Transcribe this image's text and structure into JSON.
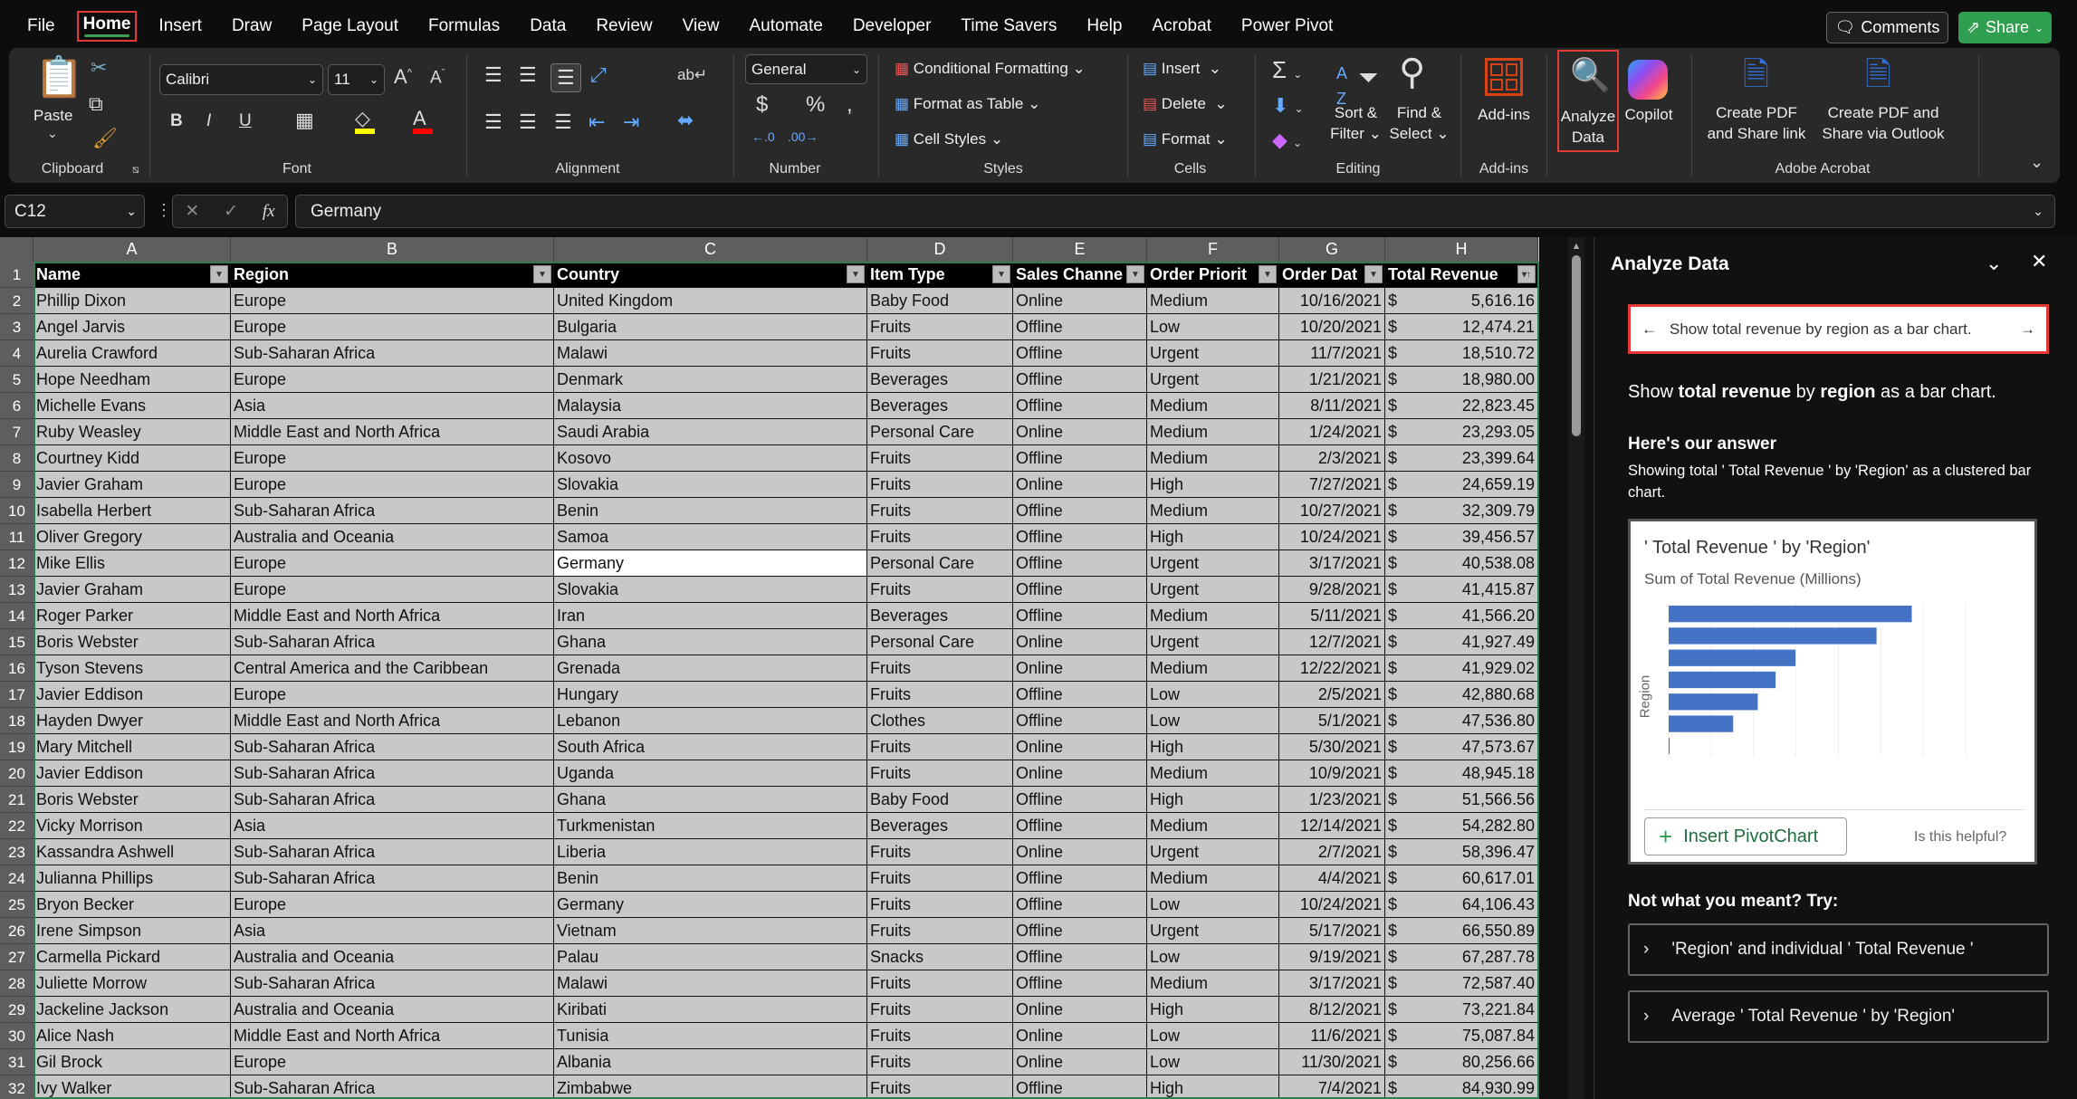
{
  "menu": [
    "File",
    "Home",
    "Insert",
    "Draw",
    "Page Layout",
    "Formulas",
    "Data",
    "Review",
    "View",
    "Automate",
    "Developer",
    "Time Savers",
    "Help",
    "Acrobat",
    "Power Pivot"
  ],
  "top_buttons": {
    "comments": "Comments",
    "share": "Share"
  },
  "ribbon": {
    "clipboard": {
      "paste": "Paste",
      "label": "Clipboard"
    },
    "font": {
      "name": "Calibri",
      "size": "11",
      "bold": "B",
      "italic": "I",
      "underline": "U",
      "label": "Font",
      "highlight_color": "#ffff00",
      "font_color": "#ff0000"
    },
    "alignment": {
      "label": "Alignment"
    },
    "number": {
      "format": "General",
      "label": "Number"
    },
    "styles": {
      "conditional": "Conditional Formatting",
      "table": "Format as Table",
      "cell": "Cell Styles",
      "label": "Styles"
    },
    "cells": {
      "insert": "Insert",
      "delete": "Delete",
      "format": "Format",
      "label": "Cells"
    },
    "editing": {
      "sort1": "Sort &",
      "sort2": "Filter",
      "find1": "Find &",
      "find2": "Select",
      "label": "Editing"
    },
    "addins": {
      "button": "Add-ins",
      "label": "Add-ins"
    },
    "analyze": {
      "line1": "Analyze",
      "line2": "Data"
    },
    "copilot": "Copilot",
    "acrobat": {
      "pdf_link1": "Create PDF",
      "pdf_link2": "and Share link",
      "pdf_outlook1": "Create PDF and",
      "pdf_outlook2": "Share via Outlook",
      "label": "Adobe Acrobat"
    }
  },
  "formula_bar": {
    "name_box": "C12",
    "value": "Germany",
    "fx": "fx"
  },
  "table": {
    "columns": [
      "A",
      "B",
      "C",
      "D",
      "E",
      "F",
      "G",
      "H"
    ],
    "headers": [
      "Name",
      "Region",
      "Country",
      "Item Type",
      "Sales Channe",
      "Order Priorit",
      "Order Dat",
      "Total Revenue"
    ],
    "currency": "$",
    "rows": [
      [
        "Phillip Dixon",
        "Europe",
        "United Kingdom",
        "Baby Food",
        "Online",
        "Medium",
        "10/16/2021",
        "5,616.16"
      ],
      [
        "Angel Jarvis",
        "Europe",
        "Bulgaria",
        "Fruits",
        "Offline",
        "Low",
        "10/20/2021",
        "12,474.21"
      ],
      [
        "Aurelia Crawford",
        "Sub-Saharan Africa",
        "Malawi",
        "Fruits",
        "Offline",
        "Urgent",
        "11/7/2021",
        "18,510.72"
      ],
      [
        "Hope Needham",
        "Europe",
        "Denmark",
        "Beverages",
        "Offline",
        "Urgent",
        "1/21/2021",
        "18,980.00"
      ],
      [
        "Michelle Evans",
        "Asia",
        "Malaysia",
        "Beverages",
        "Offline",
        "Medium",
        "8/11/2021",
        "22,823.45"
      ],
      [
        "Ruby Weasley",
        "Middle East and North Africa",
        "Saudi Arabia",
        "Personal Care",
        "Online",
        "Medium",
        "1/24/2021",
        "23,293.05"
      ],
      [
        "Courtney Kidd",
        "Europe",
        "Kosovo",
        "Fruits",
        "Offline",
        "Medium",
        "2/3/2021",
        "23,399.64"
      ],
      [
        "Javier Graham",
        "Europe",
        "Slovakia",
        "Fruits",
        "Online",
        "High",
        "7/27/2021",
        "24,659.19"
      ],
      [
        "Isabella Herbert",
        "Sub-Saharan Africa",
        "Benin",
        "Fruits",
        "Offline",
        "Medium",
        "10/27/2021",
        "32,309.79"
      ],
      [
        "Oliver Gregory",
        "Australia and Oceania",
        "Samoa",
        "Fruits",
        "Offline",
        "High",
        "10/24/2021",
        "39,456.57"
      ],
      [
        "Mike Ellis",
        "Europe",
        "Germany",
        "Personal Care",
        "Offline",
        "Urgent",
        "3/17/2021",
        "40,538.08"
      ],
      [
        "Javier Graham",
        "Europe",
        "Slovakia",
        "Fruits",
        "Offline",
        "Urgent",
        "9/28/2021",
        "41,415.87"
      ],
      [
        "Roger Parker",
        "Middle East and North Africa",
        "Iran",
        "Beverages",
        "Offline",
        "Medium",
        "5/11/2021",
        "41,566.20"
      ],
      [
        "Boris Webster",
        "Sub-Saharan Africa",
        "Ghana",
        "Personal Care",
        "Online",
        "Urgent",
        "12/7/2021",
        "41,927.49"
      ],
      [
        "Tyson Stevens",
        "Central America and the Caribbean",
        "Grenada",
        "Fruits",
        "Online",
        "Medium",
        "12/22/2021",
        "41,929.02"
      ],
      [
        "Javier Eddison",
        "Europe",
        "Hungary",
        "Fruits",
        "Offline",
        "Low",
        "2/5/2021",
        "42,880.68"
      ],
      [
        "Hayden Dwyer",
        "Middle East and North Africa",
        "Lebanon",
        "Clothes",
        "Offline",
        "Low",
        "5/1/2021",
        "47,536.80"
      ],
      [
        "Mary Mitchell",
        "Sub-Saharan Africa",
        "South Africa",
        "Fruits",
        "Online",
        "High",
        "5/30/2021",
        "47,573.67"
      ],
      [
        "Javier Eddison",
        "Sub-Saharan Africa",
        "Uganda",
        "Fruits",
        "Online",
        "Medium",
        "10/9/2021",
        "48,945.18"
      ],
      [
        "Boris Webster",
        "Sub-Saharan Africa",
        "Ghana",
        "Baby Food",
        "Offline",
        "High",
        "1/23/2021",
        "51,566.56"
      ],
      [
        "Vicky Morrison",
        "Asia",
        "Turkmenistan",
        "Beverages",
        "Offline",
        "Medium",
        "12/14/2021",
        "54,282.80"
      ],
      [
        "Kassandra Ashwell",
        "Sub-Saharan Africa",
        "Liberia",
        "Fruits",
        "Online",
        "Urgent",
        "2/7/2021",
        "58,396.47"
      ],
      [
        "Julianna Phillips",
        "Sub-Saharan Africa",
        "Benin",
        "Fruits",
        "Offline",
        "Medium",
        "4/4/2021",
        "60,617.01"
      ],
      [
        "Bryon Becker",
        "Europe",
        "Germany",
        "Fruits",
        "Offline",
        "Low",
        "10/24/2021",
        "64,106.43"
      ],
      [
        "Irene Simpson",
        "Asia",
        "Vietnam",
        "Fruits",
        "Offline",
        "Urgent",
        "5/17/2021",
        "66,550.89"
      ],
      [
        "Carmella Pickard",
        "Australia and Oceania",
        "Palau",
        "Snacks",
        "Offline",
        "Low",
        "9/19/2021",
        "67,287.78"
      ],
      [
        "Juliette Morrow",
        "Sub-Saharan Africa",
        "Malawi",
        "Fruits",
        "Offline",
        "Medium",
        "3/17/2021",
        "72,587.40"
      ],
      [
        "Jackeline Jackson",
        "Australia and Oceania",
        "Kiribati",
        "Fruits",
        "Online",
        "High",
        "8/12/2021",
        "73,221.84"
      ],
      [
        "Alice Nash",
        "Middle East and North Africa",
        "Tunisia",
        "Fruits",
        "Online",
        "Low",
        "11/6/2021",
        "75,087.84"
      ],
      [
        "Gil Brock",
        "Europe",
        "Albania",
        "Fruits",
        "Online",
        "Low",
        "11/30/2021",
        "80,256.66"
      ],
      [
        "Ivy Walker",
        "Sub-Saharan Africa",
        "Zimbabwe",
        "Fruits",
        "Offline",
        "High",
        "7/4/2021",
        "84,930.99"
      ]
    ]
  },
  "panel": {
    "title": "Analyze Data",
    "query": "Show total revenue by region as a bar chart.",
    "echo": {
      "a": "Show ",
      "b": "total revenue",
      "c": " by ",
      "d": "region",
      "e": " as a bar chart."
    },
    "answer_heading": "Here's our answer",
    "answer_desc": "Showing total ' Total Revenue ' by 'Region' as a clustered bar chart.",
    "insert_button": "Insert PivotChart",
    "helpful": "Is this helpful?",
    "not_meant": "Not what you meant? Try:",
    "suggestions": [
      "'Region' and individual ' Total Revenue '",
      "Average ' Total Revenue ' by 'Region'"
    ]
  },
  "chart_data": {
    "type": "bar",
    "orientation": "horizontal",
    "title": "' Total Revenue ' by 'Region'",
    "subtitle": "Sum of Total Revenue (Millions)",
    "ylabel": "Region",
    "values": [
      5.73,
      4.9,
      2.99,
      2.52,
      2.1,
      1.52,
      0.02
    ],
    "xlim": [
      0,
      7
    ],
    "grid": true,
    "color": "#4472c4"
  }
}
